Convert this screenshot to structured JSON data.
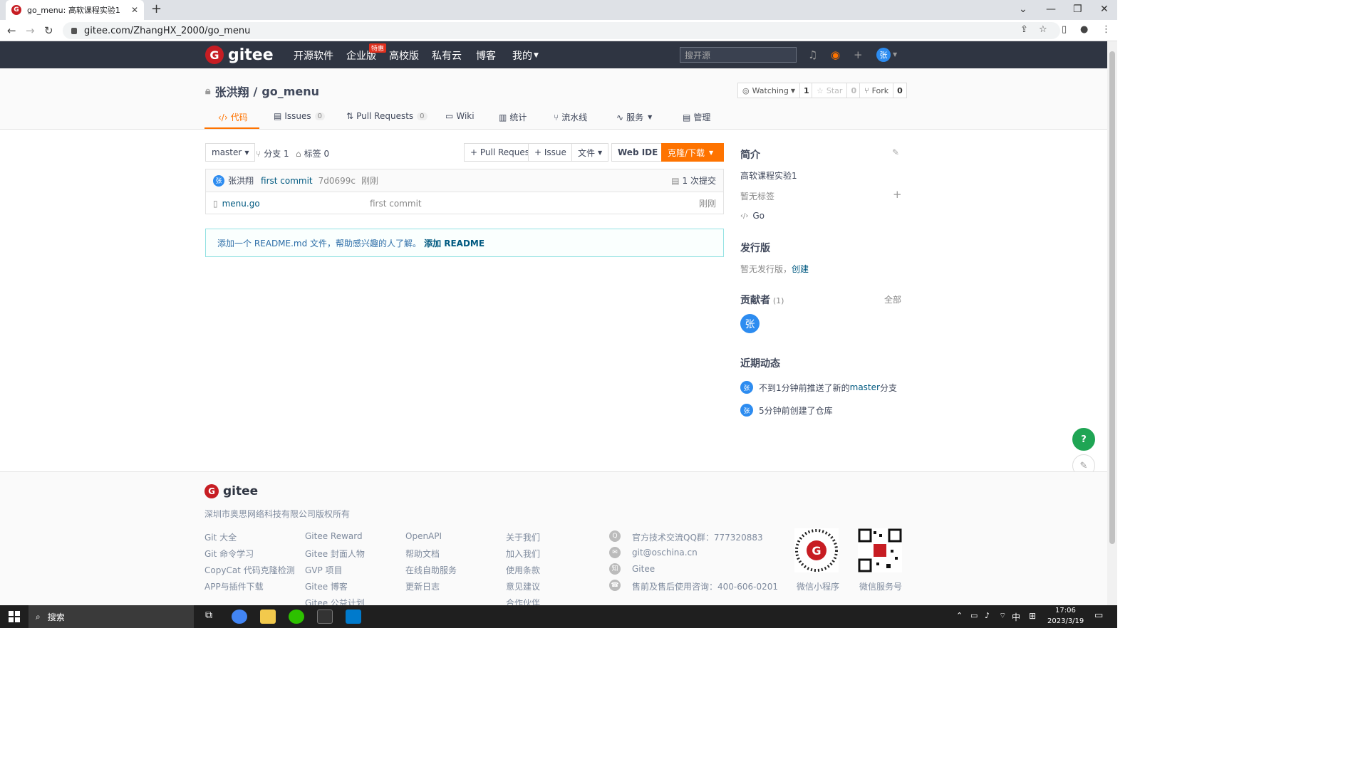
{
  "browser": {
    "tab_title": "go_menu: 高软课程实验1",
    "url": "gitee.com/ZhangHX_2000/go_menu"
  },
  "header": {
    "logo": "gitee",
    "nav": [
      "开源软件",
      "企业版",
      "高校版",
      "私有云",
      "博客",
      "我的"
    ],
    "badge": "特惠",
    "search_placeholder": "搜开源",
    "avatar": "张"
  },
  "repo": {
    "owner": "张洪翔",
    "name": "go_menu",
    "sep": "/",
    "watching": "Watching",
    "watch_count": "1",
    "star": "Star",
    "star_count": "0",
    "fork": "Fork",
    "fork_count": "0",
    "tabs": [
      {
        "label": "代码"
      },
      {
        "label": "Issues",
        "count": "0"
      },
      {
        "label": "Pull Requests",
        "count": "0"
      },
      {
        "label": "Wiki"
      },
      {
        "label": "统计"
      },
      {
        "label": "流水线"
      },
      {
        "label": "服务"
      },
      {
        "label": "管理"
      }
    ]
  },
  "toolbar": {
    "branch": "master",
    "branches": "分支 1",
    "tags": "标签 0",
    "pull_request": "+ Pull Request",
    "issue": "+ Issue",
    "file": "文件",
    "webide": "Web IDE",
    "clone": "克隆/下载"
  },
  "commit": {
    "author": "张洪翔",
    "message": "first commit",
    "hash": "7d0699c",
    "time": "刚刚",
    "count": "1 次提交",
    "avatar": "张"
  },
  "files": [
    {
      "name": "menu.go",
      "message": "first commit",
      "time": "刚刚"
    }
  ],
  "readme": {
    "text": "添加一个 README.md 文件，帮助感兴趣的人了解。",
    "link": "添加 README"
  },
  "sidebar": {
    "intro_title": "简介",
    "intro": "高软课程实验1",
    "no_tags": "暂无标签",
    "lang": "Go",
    "release_title": "发行版",
    "no_release": "暂无发行版，",
    "create": "创建",
    "contrib_title": "贡献者",
    "contrib_count": "(1)",
    "all": "全部",
    "contrib_avatar": "张",
    "activity_title": "近期动态",
    "activities": [
      {
        "pre": "不到1分钟前推送了新的 ",
        "link": "master",
        "post": " 分支"
      },
      {
        "pre": "5分钟前创建了仓库",
        "link": "",
        "post": ""
      }
    ]
  },
  "footer": {
    "logo": "gitee",
    "copyright": "深圳市奥思网络科技有限公司版权所有",
    "col1": [
      "Git 大全",
      "Git 命令学习",
      "CopyCat 代码克隆检测",
      "APP与插件下载"
    ],
    "col2": [
      "Gitee Reward",
      "Gitee 封面人物",
      "GVP 项目",
      "Gitee 博客",
      "Gitee 公益计划"
    ],
    "col3": [
      "OpenAPI",
      "帮助文档",
      "在线自助服务",
      "更新日志"
    ],
    "col4": [
      "关于我们",
      "加入我们",
      "使用条款",
      "意见建议",
      "合作伙伴"
    ],
    "contact": [
      "官方技术交流QQ群：777320883",
      "git@oschina.cn",
      "Gitee",
      "售前及售后使用咨询：400-606-0201"
    ],
    "qr1": "微信小程序",
    "qr2": "微信服务号"
  },
  "taskbar": {
    "search": "搜索",
    "time": "17:06",
    "date": "2023/3/19",
    "ime": "中"
  }
}
